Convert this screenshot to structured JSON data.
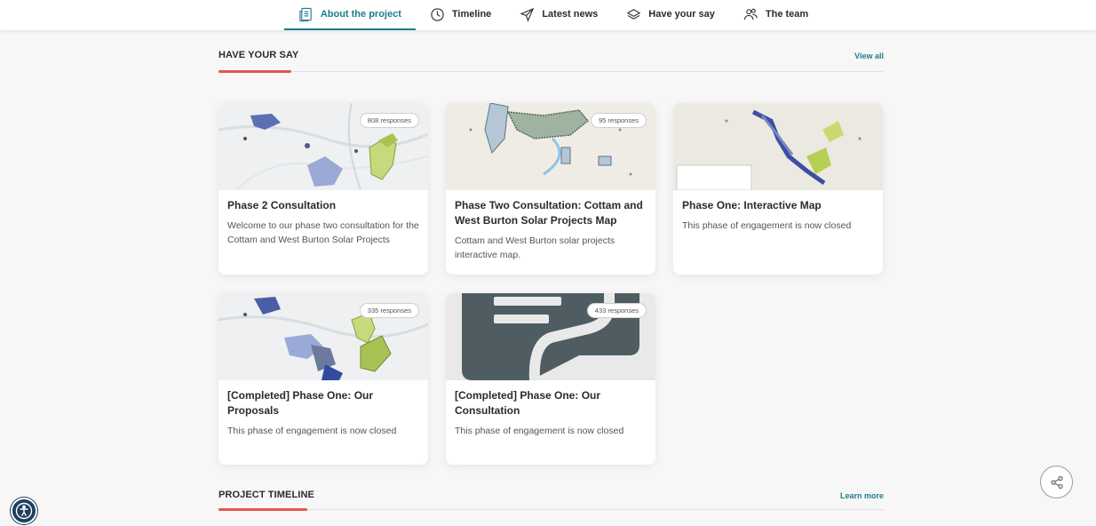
{
  "nav": {
    "tabs": [
      {
        "label": "About the project",
        "icon": "document-icon"
      },
      {
        "label": "Timeline",
        "icon": "clock-icon"
      },
      {
        "label": "Latest news",
        "icon": "send-icon"
      },
      {
        "label": "Have your say",
        "icon": "layers-icon"
      },
      {
        "label": "The team",
        "icon": "people-icon"
      }
    ],
    "active_tab": "About the project",
    "accent_color": "#1e7d88"
  },
  "have_your_say": {
    "title": "HAVE YOUR SAY",
    "link": "View all",
    "cards": [
      {
        "responses": "808 responses",
        "title": "Phase 2 Consultation",
        "description": "Welcome to our phase two consultation for the Cottam and West Burton Solar Projects",
        "image": "map-thumbnail"
      },
      {
        "responses": "95 responses",
        "title": "Phase Two Consultation: Cottam and West Burton Solar Projects Map",
        "description": "Cottam and West Burton solar projects interactive map.",
        "image": "map-thumbnail"
      },
      {
        "responses": "",
        "title": "Phase One: Interactive Map",
        "description": "This phase of engagement is now closed",
        "image": "map-thumbnail"
      },
      {
        "responses": "335 responses",
        "title": "[Completed] Phase One: Our Proposals",
        "description": "This phase of engagement is now closed",
        "image": "map-thumbnail"
      },
      {
        "responses": "433 responses",
        "title": "[Completed] Phase One: Our Consultation",
        "description": "This phase of engagement is now closed",
        "image": "chat-bubble-graphic"
      }
    ]
  },
  "project_timeline": {
    "title": "PROJECT TIMELINE",
    "link": "Learn more"
  },
  "colors": {
    "section_underline": "#e4574a",
    "link": "#1e7d88",
    "accessibility_button": "#1b3f5c"
  },
  "floating": {
    "accessibility_icon": "accessibility-icon",
    "share_icon": "share-icon"
  }
}
